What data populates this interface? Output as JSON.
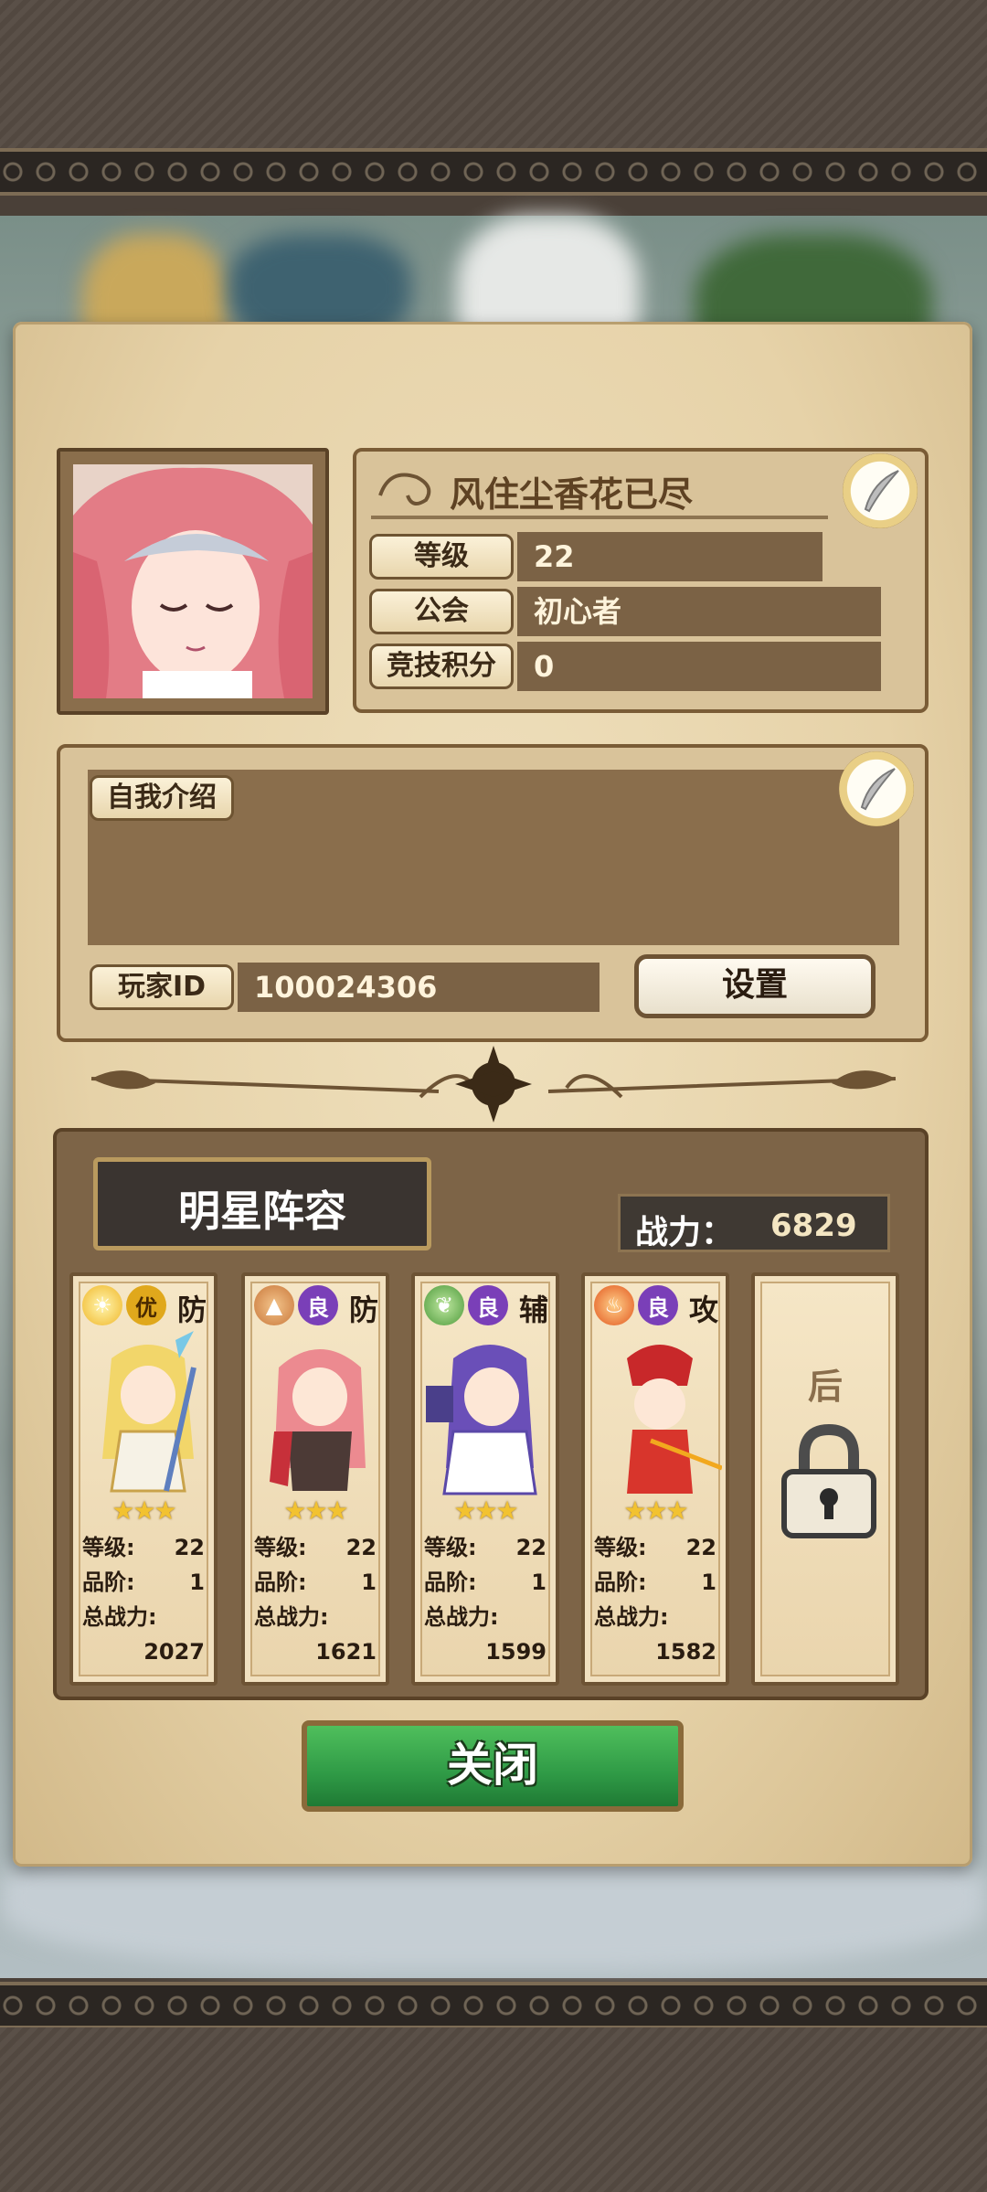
{
  "profile": {
    "player_name": "风住尘香花已尽",
    "level_label": "等级",
    "level_value": "22",
    "guild_label": "公会",
    "guild_value": "初心者",
    "arena_label": "竞技积分",
    "arena_value": "0"
  },
  "intro": {
    "label": "自我介绍",
    "text": ""
  },
  "player_id": {
    "label": "玩家ID",
    "value": "100024306",
    "settings_label": "设置"
  },
  "lineup": {
    "title": "明星阵容",
    "power_label": "战力：",
    "power_value": "6829",
    "stat_labels": {
      "level": "等级:",
      "grade": "品阶:",
      "total_power": "总战力:"
    },
    "heroes": [
      {
        "quality": "优",
        "role": "防",
        "element": "light",
        "stars": 3,
        "level": "22",
        "grade": "1",
        "power": "2027"
      },
      {
        "quality": "良",
        "role": "防",
        "element": "earth",
        "stars": 3,
        "level": "22",
        "grade": "1",
        "power": "1621"
      },
      {
        "quality": "良",
        "role": "辅",
        "element": "wind",
        "stars": 3,
        "level": "22",
        "grade": "1",
        "power": "1599"
      },
      {
        "quality": "良",
        "role": "攻",
        "element": "fire",
        "stars": 3,
        "level": "22",
        "grade": "1",
        "power": "1582"
      }
    ],
    "locked_slot": {
      "label": "后",
      "icon": "lock-icon"
    }
  },
  "close_label": "关闭",
  "colors": {
    "accent_green": "#2f9a46",
    "quality_purple": "#7a3fb8",
    "quality_gold": "#e0a81c",
    "parchment": "#e9d7ae"
  }
}
